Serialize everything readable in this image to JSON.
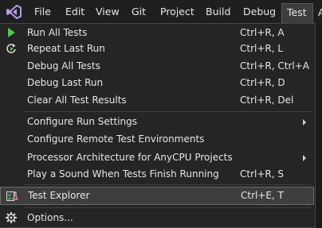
{
  "menubar": {
    "items": [
      {
        "label": "File"
      },
      {
        "label": "Edit"
      },
      {
        "label": "View"
      },
      {
        "label": "Git"
      },
      {
        "label": "Project"
      },
      {
        "label": "Build"
      },
      {
        "label": "Debug"
      },
      {
        "label": "Test"
      }
    ],
    "overflow_label": "A"
  },
  "test_menu": {
    "items": [
      {
        "label": "Run All Tests",
        "shortcut": "Ctrl+R, A",
        "icon": "play-icon"
      },
      {
        "label": "Repeat Last Run",
        "shortcut": "Ctrl+R, L",
        "icon": "repeat-icon"
      },
      {
        "label": "Debug All Tests",
        "shortcut": "Ctrl+R, Ctrl+A"
      },
      {
        "label": "Debug Last Run",
        "shortcut": "Ctrl+R, D"
      },
      {
        "label": "Clear All Test Results",
        "shortcut": "Ctrl+R, Del"
      },
      {
        "label": "Configure Run Settings",
        "shortcut": "",
        "submenu": true
      },
      {
        "label": "Configure Remote Test Environments",
        "shortcut": ""
      },
      {
        "label": "Processor Architecture for AnyCPU Projects",
        "shortcut": "",
        "submenu": true
      },
      {
        "label": "Play a Sound When Tests Finish Running",
        "shortcut": "Ctrl+R, S"
      },
      {
        "label": "Test Explorer",
        "shortcut": "Ctrl+E, T",
        "icon": "test-explorer-icon",
        "highlighted": true
      },
      {
        "label": "Options...",
        "shortcut": "",
        "icon": "gear-icon"
      }
    ]
  },
  "colors": {
    "background": "#1f1f1f",
    "menu_bg": "#252526",
    "highlight": "#3e3e40",
    "play_green": "#4ec94e",
    "vs_purple": "#8661c5"
  }
}
